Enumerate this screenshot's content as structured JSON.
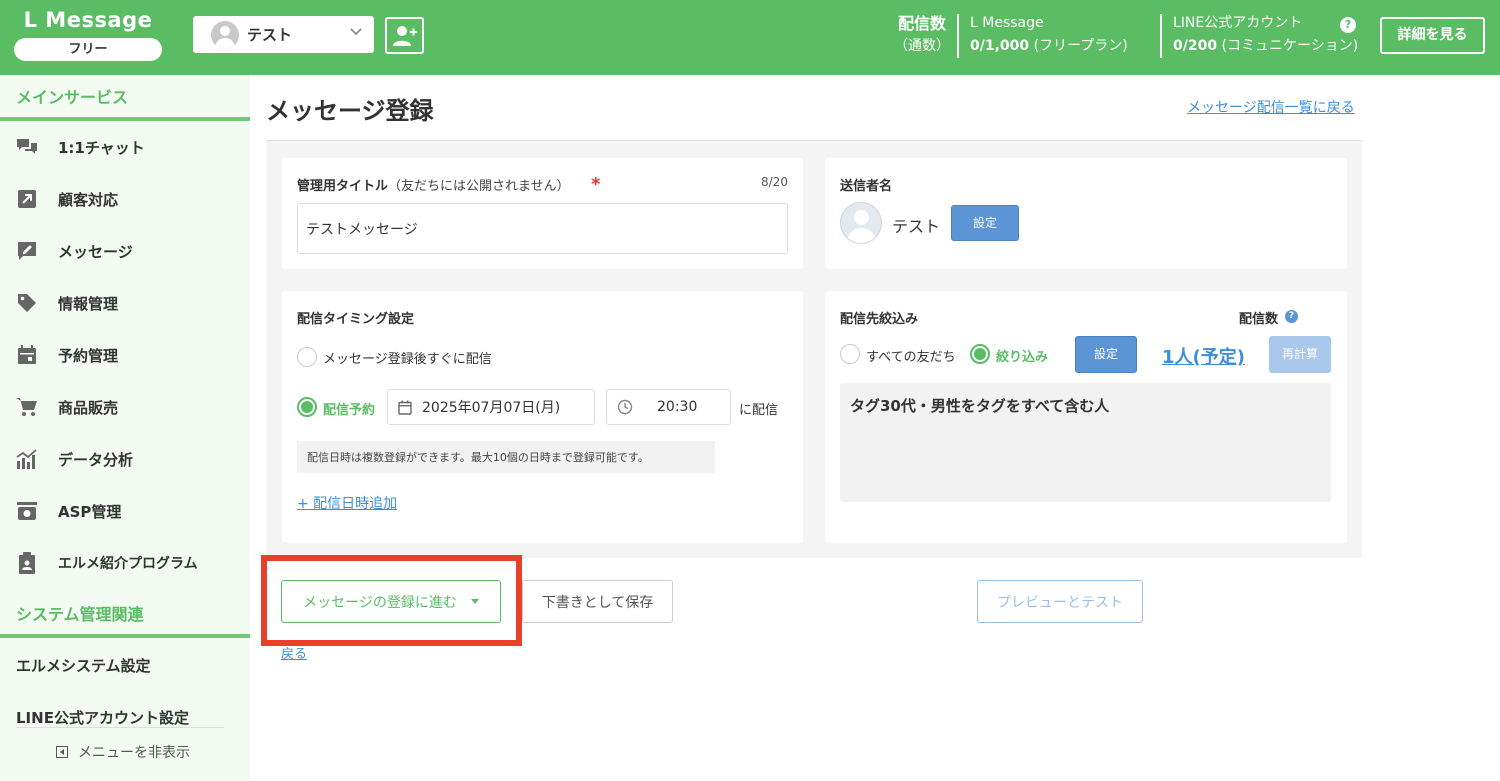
{
  "header": {
    "logo": "L Message",
    "plan": "フリー",
    "account_name": "テスト",
    "stats_label": "配信数",
    "stats_unit": "（通数）",
    "lm_label": "L Message",
    "lm_value": "0/1,000",
    "lm_plan": "(フリープラン)",
    "line_label": "LINE公式アカウント",
    "line_value": "0/200",
    "line_plan": "(コミュニケーション)",
    "details_button": "詳細を見る",
    "accent_color": "#5abd64"
  },
  "sidebar": {
    "main_section": "メインサービス",
    "items": [
      {
        "label": "1:1チャット",
        "icon": "chat-icon"
      },
      {
        "label": "顧客対応",
        "icon": "arrow-up-right-icon"
      },
      {
        "label": "メッセージ",
        "icon": "message-icon"
      },
      {
        "label": "情報管理",
        "icon": "tag-icon"
      },
      {
        "label": "予約管理",
        "icon": "calendar-icon"
      },
      {
        "label": "商品販売",
        "icon": "cart-icon"
      },
      {
        "label": "データ分析",
        "icon": "chart-icon"
      },
      {
        "label": "ASP管理",
        "icon": "asp-icon"
      },
      {
        "label": "エルメ紹介プログラム",
        "icon": "clipboard-icon"
      }
    ],
    "system_section": "システム管理関連",
    "system_items": [
      "エルメシステム設定",
      "LINE公式アカウント設定"
    ],
    "hide_menu": "メニューを非表示"
  },
  "main": {
    "page_title": "メッセージ登録",
    "back_to_list": "メッセージ配信一覧に戻る",
    "admin_title": {
      "label": "管理用タイトル",
      "sub": "（友だちには公開されません）",
      "required_mark": "*",
      "counter": "8/20",
      "value": "テストメッセージ"
    },
    "sender": {
      "label": "送信者名",
      "name": "テスト",
      "set_button": "設定"
    },
    "timing": {
      "label": "配信タイミング設定",
      "option_immediate": "メッセージ登録後すぐに配信",
      "option_scheduled": "配信予約",
      "date": "2025年07月07日(月)",
      "time": "20:30",
      "suffix": "に配信",
      "note": "配信日時は複数登録ができます。最大10個の日時まで登録可能です。",
      "add_link": "+ 配信日時追加"
    },
    "target": {
      "label": "配信先絞込み",
      "count_label": "配信数",
      "option_all": "すべての友だち",
      "option_filter": "絞り込み",
      "set_button": "設定",
      "count_value": "1人(予定)",
      "recalc_button": "再計算",
      "condition": "タグ30代・男性をタグをすべて含む人"
    },
    "actions": {
      "proceed": "メッセージの登録に進む",
      "save_draft": "下書きとして保存",
      "preview": "プレビューとテスト",
      "back": "戻る"
    }
  }
}
